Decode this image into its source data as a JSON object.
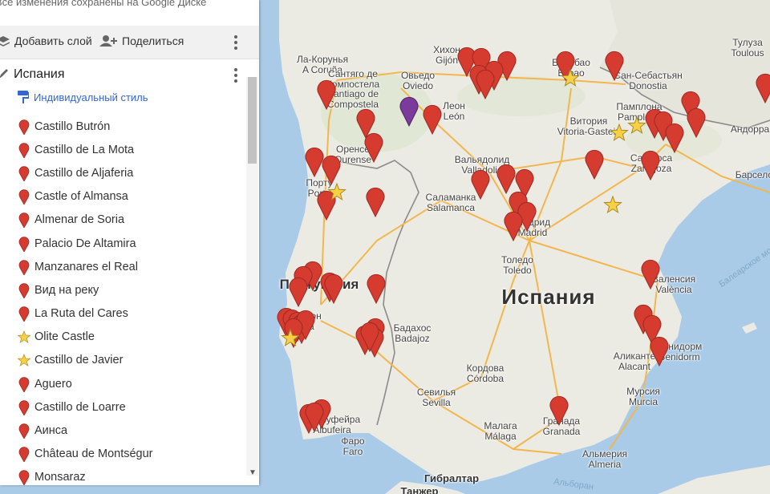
{
  "panel": {
    "status_text": "Все изменения сохранены на Google Диске",
    "add_layer_label": "Добавить слой",
    "share_label": "Поделиться",
    "layer_title": "Испания",
    "style_label": "Индивидуальный стиль",
    "items": [
      {
        "label": "Castillo Butrón",
        "icon": "red-marker-icon"
      },
      {
        "label": "Castillo de La Mota",
        "icon": "red-marker-icon"
      },
      {
        "label": "Castillo de Aljaferia",
        "icon": "red-marker-icon"
      },
      {
        "label": "Castle of Almansa",
        "icon": "red-marker-icon"
      },
      {
        "label": "Almenar de Soria",
        "icon": "red-marker-icon"
      },
      {
        "label": "Palacio De Altamira",
        "icon": "red-marker-icon"
      },
      {
        "label": "Manzanares el Real",
        "icon": "red-marker-icon"
      },
      {
        "label": "Вид на реку",
        "icon": "red-marker-icon"
      },
      {
        "label": "La Ruta del Cares",
        "icon": "red-marker-icon"
      },
      {
        "label": "Olite Castle",
        "icon": "yellow-star-icon"
      },
      {
        "label": "Castillo de Javier",
        "icon": "yellow-star-icon"
      },
      {
        "label": "Aguero",
        "icon": "red-marker-icon"
      },
      {
        "label": "Castillo de Loarre",
        "icon": "red-marker-icon"
      },
      {
        "label": "Аинса",
        "icon": "red-marker-icon"
      },
      {
        "label": "Château de Montségur",
        "icon": "red-marker-icon"
      },
      {
        "label": "Monsaraz",
        "icon": "red-marker-icon"
      }
    ]
  },
  "map": {
    "country_label": "Испания",
    "portugal_label": "Португалия",
    "colors": {
      "water": "#a9cbe8",
      "land": "#ecebe3",
      "france": "#e6e5dc",
      "marker": "#d63b30",
      "star": "#f7d046",
      "road": "#f2b64e",
      "border": "#8a8a8a"
    },
    "cities": [
      "Ла-Корунья\nA Coruña",
      "Сантяго де\nКомпостела\nSantiago de\nCompostela",
      "Оренсе\nOurense",
      "Порту\nPorto",
      "Хихон\nGijón",
      "Овьедо\nOviedo",
      "Леон\nLeón",
      "Бильбао\nBilbao",
      "Сан-Себастьян\nDonostia",
      "Памплона\nPamplona",
      "Витория\nVitoria-Gasteiz",
      "Вальядолид\nValladolid",
      "Саламанка\nSalamanca",
      "Сарагоса\nZaragoza",
      "Мадрид\nMadrid",
      "Толедо\nToledo",
      "Валенсия\nValència",
      "Бадахос\nBadajoz",
      "Кордова\nCórdoba",
      "Севилья\nSevilla",
      "Гранада\nGranada",
      "Малага\nMálaga",
      "Аликанте\nAlacant",
      "Мурсия\nMurcia",
      "Альмерия\nAlmeria",
      "Фаро\nFaro",
      "Лиссабон\nLisboa",
      "Альбуфейра\nAlbufeira",
      "Бенидорм\nBenidorm",
      "Тулуза\nToulous",
      "Андорра",
      "Барселона"
    ],
    "sea_labels": [
      "Балеарское море",
      "Альборан"
    ],
    "bottom_labels": [
      "Гибралтар",
      "Танжер"
    ],
    "red_markers": 69,
    "purple_markers": 1,
    "star_markers": 6
  }
}
